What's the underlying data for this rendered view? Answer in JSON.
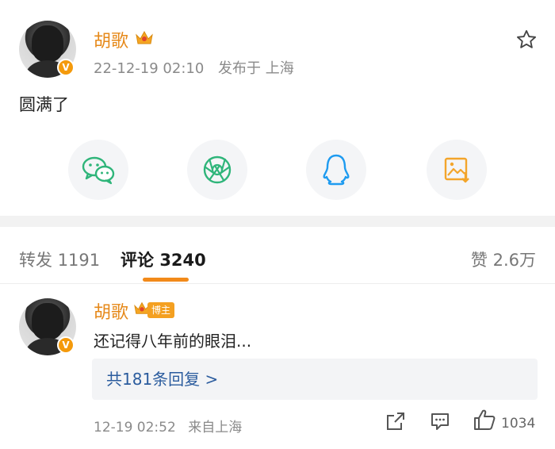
{
  "post": {
    "author": "胡歌",
    "time": "22-12-19 02:10",
    "location": "发布于 上海",
    "text": "圆满了"
  },
  "tabs": {
    "repost_label": "转发",
    "repost_count": "1191",
    "comment_label": "评论",
    "comment_count": "3240",
    "like_label": "赞",
    "like_count": "2.6万"
  },
  "comment": {
    "author": "胡歌",
    "host_tag": "博主",
    "text": "还记得八年前的眼泪...",
    "reply_link": "共181条回复 >",
    "time": "12-19 02:52",
    "source": "来自上海",
    "like_count": "1034"
  },
  "colors": {
    "accent_orange": "#f28a1a",
    "author_orange": "#e6891a",
    "link_blue": "#2b5c9e",
    "wechat_green": "#2fb57a",
    "qq_blue": "#1e9bf0",
    "save_orange": "#f3a52b"
  },
  "icons": [
    "star-icon",
    "wechat-icon",
    "moments-icon",
    "qq-icon",
    "save-image-icon",
    "share-icon",
    "comment-icon",
    "like-icon",
    "crown-icon",
    "verified-v-icon"
  ]
}
